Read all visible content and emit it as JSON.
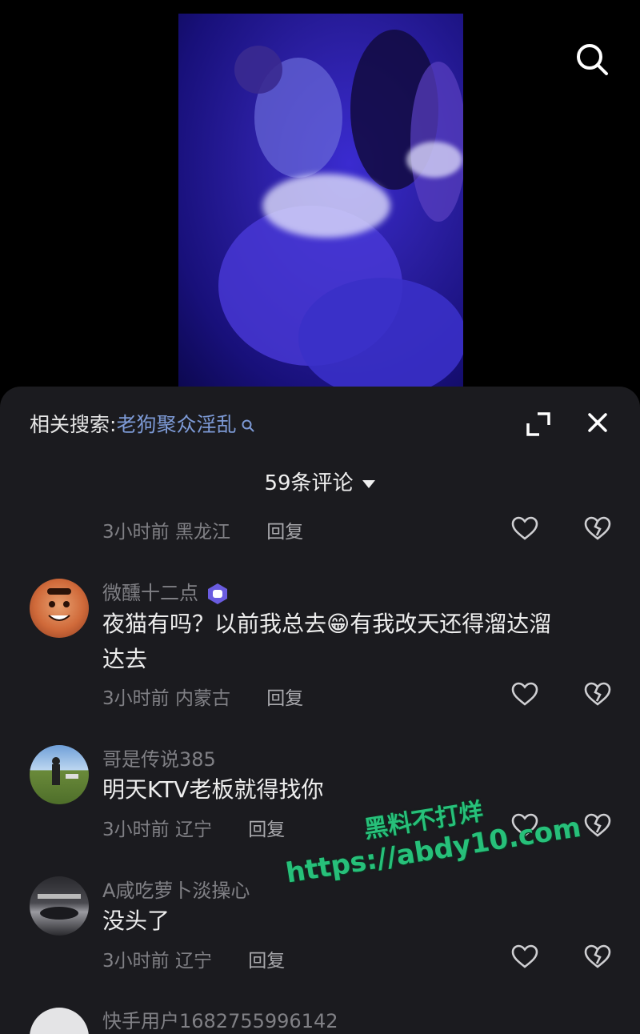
{
  "video": {
    "search_icon": "search-icon"
  },
  "panel": {
    "related_label": "相关搜索:",
    "related_keyword": "老狗聚众淫乱",
    "comment_count": "59条评论",
    "icons": {
      "expand": "expand-icon",
      "close": "close-icon",
      "caret": "caret-down-icon"
    }
  },
  "first_meta": {
    "time": "3小时前",
    "location": "黑龙江",
    "reply": "回复"
  },
  "comments": [
    {
      "user": "微醺十二点",
      "text_line1": "夜猫有吗？以前我总去😁有我改天还得溜达溜",
      "text_line2": "达去",
      "time": "3小时前",
      "location": "内蒙古",
      "reply": "回复"
    },
    {
      "user": "哥是传说385",
      "text": "明天KTV老板就得找你",
      "time": "3小时前",
      "location": "辽宁",
      "reply": "回复"
    },
    {
      "user": "A咸吃萝卜淡操心",
      "text": "没头了",
      "time": "3小时前",
      "location": "辽宁",
      "reply": "回复"
    },
    {
      "user": "快手用户1682755996142"
    }
  ],
  "watermark": {
    "line1": "黑料不打烊",
    "line2": "https://abdy10.com"
  },
  "colors": {
    "panel_bg": "#1b1b1f",
    "link": "#7d9ad6",
    "watermark": "#27c07a"
  }
}
